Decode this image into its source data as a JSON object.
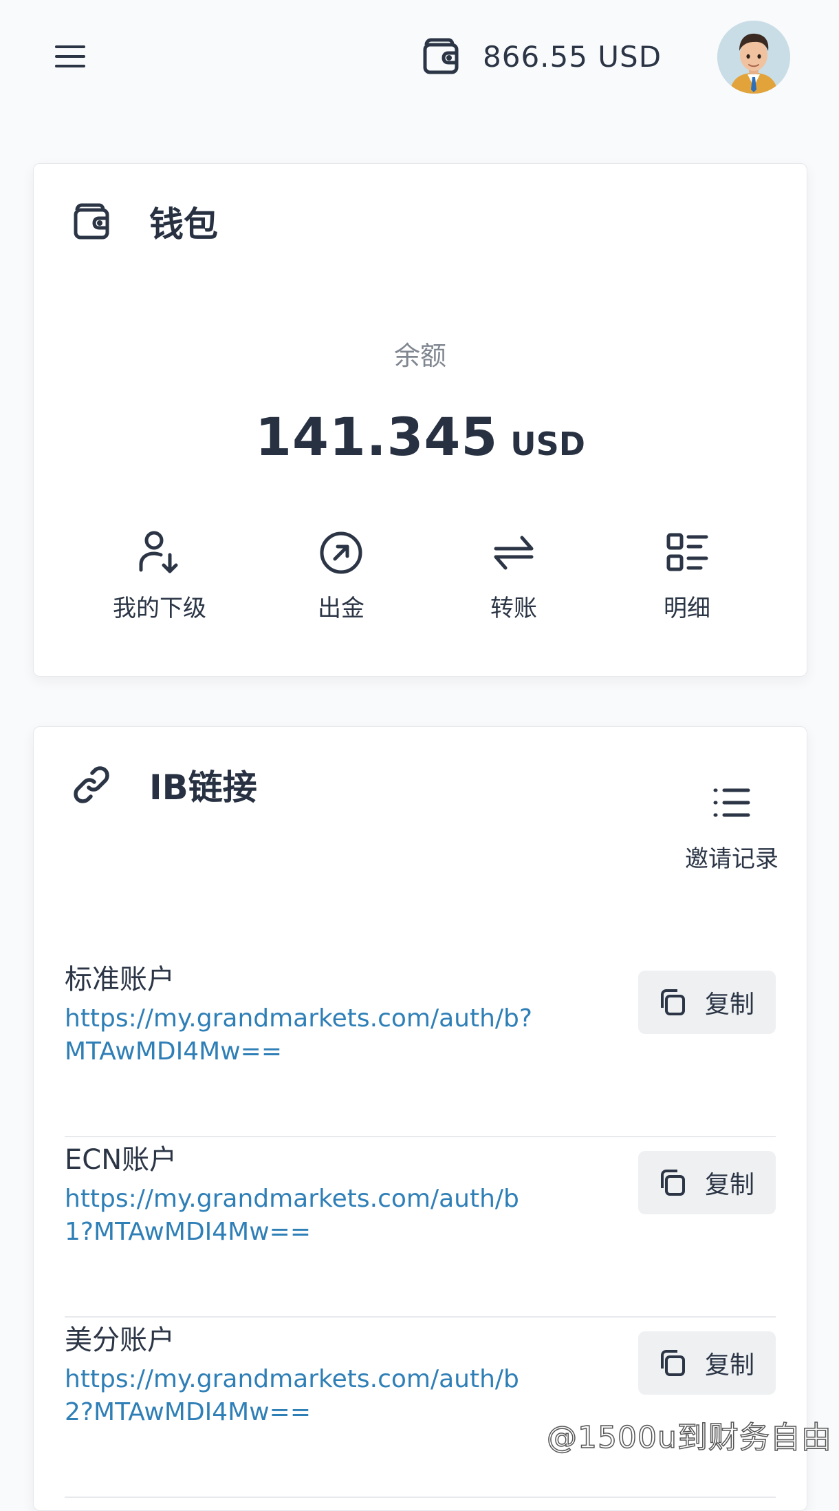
{
  "header": {
    "menu_icon": "hamburger-menu-icon",
    "wallet_icon": "wallet-icon",
    "balance": "866.55 USD",
    "avatar": "user-avatar"
  },
  "wallet_card": {
    "title": "钱包",
    "icon": "wallet-icon",
    "balance_label": "余额",
    "balance_amount": "141.345",
    "balance_currency": "USD",
    "actions": [
      {
        "label": "我的下级",
        "icon": "user-down-arrow-icon"
      },
      {
        "label": "出金",
        "icon": "circle-arrow-up-right-icon"
      },
      {
        "label": "转账",
        "icon": "transfer-arrows-icon"
      },
      {
        "label": "明细",
        "icon": "list-details-icon"
      }
    ]
  },
  "ib_card": {
    "title": "IB链接",
    "icon": "link-icon",
    "invite_label": "邀请记录",
    "invite_icon": "list-icon",
    "copy_label": "复制",
    "links": [
      {
        "name": "标准账户",
        "url": "https://my.grandmarkets.com/auth/b?MTAwMDI4Mw=="
      },
      {
        "name": "ECN账户",
        "url": "https://my.grandmarkets.com/auth/b1?MTAwMDI4Mw=="
      },
      {
        "name": "美分账户",
        "url": "https://my.grandmarkets.com/auth/b2?MTAwMDI4Mw=="
      }
    ]
  },
  "watermark": "@1500u到财务自由"
}
